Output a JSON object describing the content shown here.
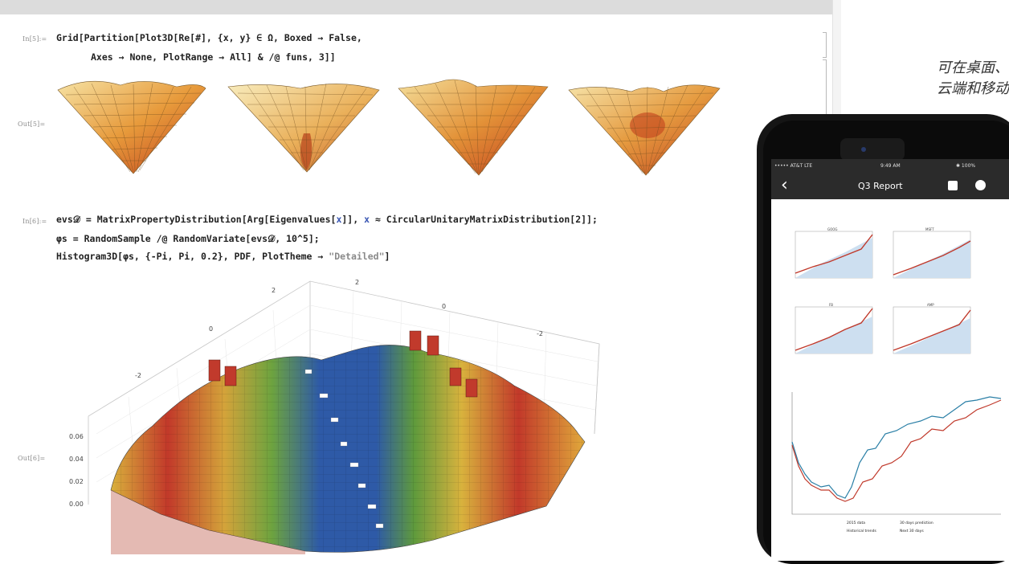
{
  "tagline": {
    "line1": "可在桌面、",
    "line2": "云端和移动"
  },
  "cells": {
    "in5_label": "In[5]:=",
    "in5_line1": "Grid[Partition[Plot3D[Re[#], {x, y} ∈ Ω, Boxed → False,",
    "in5_line2": "Axes → None, PlotRange → All] & /@ funs, 3]]",
    "out5_label": "Out[5]=",
    "in6_label": "In[6]:=",
    "in6_line1a": "evs𝒟 = MatrixPropertyDistribution[Arg[Eigenvalues[",
    "in6_line1b": "x",
    "in6_line1c": "]], ",
    "in6_line1d": "x",
    "in6_line1e": " ≈ CircularUnitaryMatrixDistribution[2]];",
    "in6_line2": "φs = RandomSample /@ RandomVariate[evs𝒟, 10^5];",
    "in6_line3a": "Histogram3D[φs, {-Pi, Pi, 0.2}, PDF, PlotTheme → ",
    "in6_line3b": "\"Detailed\"",
    "in6_line3c": "]",
    "out6_label": "Out[6]="
  },
  "histogram": {
    "z_ticks": [
      "0.06",
      "0.04",
      "0.02",
      "0.00"
    ],
    "x_ticks": [
      "-2",
      "0",
      "2"
    ],
    "y_ticks": [
      "2",
      "0",
      "-2"
    ],
    "colors": [
      "#c0392b",
      "#e8c547",
      "#5a9c3c",
      "#2f55a4",
      "#e05a2a"
    ]
  },
  "phone": {
    "status_left": "••••• AT&T  LTE",
    "status_time": "9:49 AM",
    "status_right": "✱ 100%",
    "nav_title": "Q3 Report",
    "back_icon": "‹",
    "chart_titles": [
      "GOOG",
      "MSFT",
      "FB",
      "AMP"
    ],
    "legend": [
      "2015 data",
      "30 days prediction",
      "Historical trends",
      "Next 30 days"
    ]
  }
}
